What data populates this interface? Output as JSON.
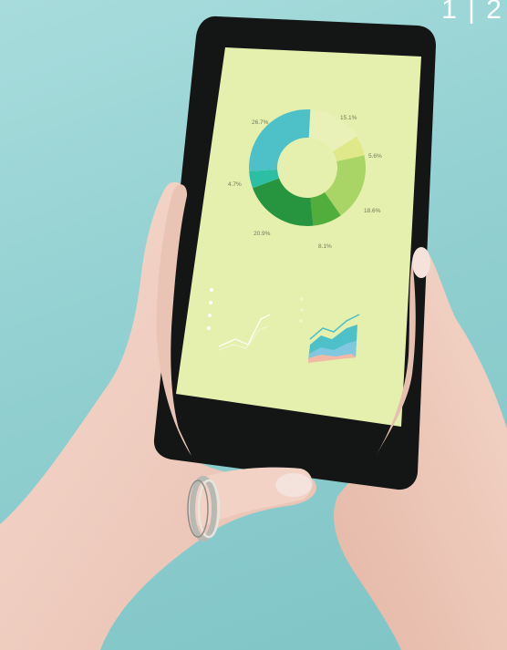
{
  "corner_text": "1 | 2",
  "colors": {
    "background": "#92d0d1",
    "phone_body": "#141616",
    "screen": "#e6f0ae",
    "skin": "#f0cfc2"
  },
  "donut": {
    "labels": [
      "26.7%",
      "15.1%",
      "5.6%",
      "18.6%",
      "8.1%",
      "20.9%",
      "4.7%"
    ],
    "segments": [
      {
        "value": 15.1,
        "color": "#e9f1b9"
      },
      {
        "value": 5.6,
        "color": "#dfe98a"
      },
      {
        "value": 18.6,
        "color": "#a9d466"
      },
      {
        "value": 8.1,
        "color": "#52ae3c"
      },
      {
        "value": 20.9,
        "color": "#279440"
      },
      {
        "value": 4.7,
        "color": "#2dbfa4"
      },
      {
        "value": 26.7,
        "color": "#4ec0c7"
      }
    ]
  },
  "icons": [
    "phone-icon",
    "ring-icon"
  ]
}
